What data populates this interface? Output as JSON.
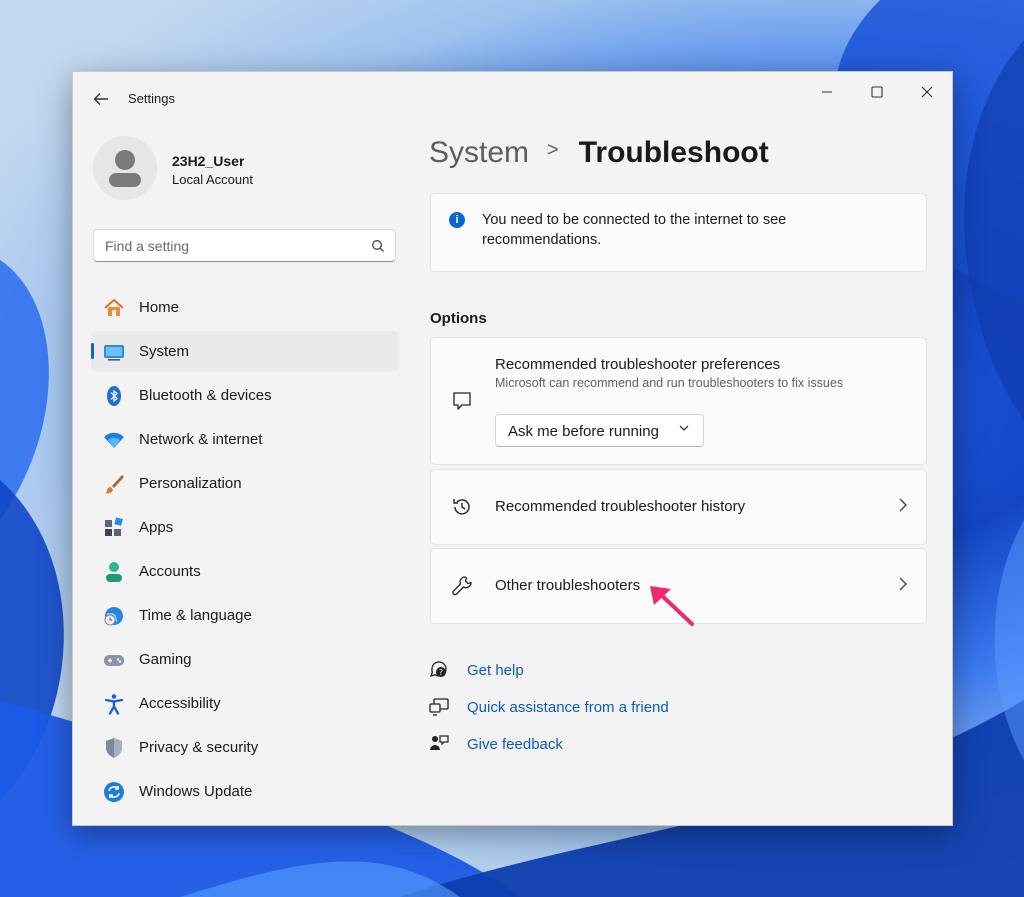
{
  "window": {
    "app_title": "Settings"
  },
  "profile": {
    "name": "23H2_User",
    "account_type": "Local Account"
  },
  "search": {
    "placeholder": "Find a setting"
  },
  "nav": {
    "items": [
      {
        "label": "Home",
        "icon": "home-icon"
      },
      {
        "label": "System",
        "icon": "monitor-icon",
        "selected": true
      },
      {
        "label": "Bluetooth & devices",
        "icon": "bluetooth-icon"
      },
      {
        "label": "Network & internet",
        "icon": "wifi-icon"
      },
      {
        "label": "Personalization",
        "icon": "brush-icon"
      },
      {
        "label": "Apps",
        "icon": "apps-icon"
      },
      {
        "label": "Accounts",
        "icon": "person-icon"
      },
      {
        "label": "Time & language",
        "icon": "globe-clock-icon"
      },
      {
        "label": "Gaming",
        "icon": "gamepad-icon"
      },
      {
        "label": "Accessibility",
        "icon": "accessibility-icon"
      },
      {
        "label": "Privacy & security",
        "icon": "shield-icon"
      },
      {
        "label": "Windows Update",
        "icon": "update-icon"
      }
    ]
  },
  "breadcrumb": {
    "parent": "System",
    "separator": ">",
    "current": "Troubleshoot"
  },
  "info_banner": {
    "text": "You need to be connected to the internet to see recommendations."
  },
  "options": {
    "heading": "Options",
    "preferences": {
      "title": "Recommended troubleshooter preferences",
      "subtitle": "Microsoft can recommend and run troubleshooters to fix issues",
      "dropdown_value": "Ask me before running"
    },
    "history": {
      "title": "Recommended troubleshooter history"
    },
    "other": {
      "title": "Other troubleshooters"
    }
  },
  "links": {
    "get_help": "Get help",
    "quick_assist": "Quick assistance from a friend",
    "feedback": "Give feedback"
  },
  "colors": {
    "accent": "#0a66d0",
    "link": "#0a5cba",
    "annotation_arrow": "#f0286e"
  }
}
